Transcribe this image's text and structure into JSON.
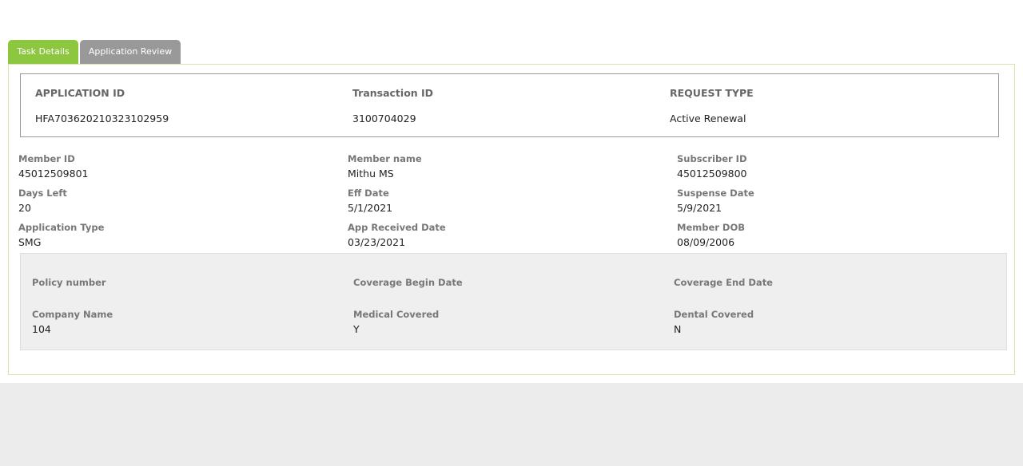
{
  "tabs": [
    {
      "label": "Task Details",
      "active": true
    },
    {
      "label": "Application Review",
      "active": false
    }
  ],
  "summary": {
    "application_id": {
      "label": "APPLICATION ID",
      "value": "HFA703620210323102959"
    },
    "transaction_id": {
      "label": "Transaction ID",
      "value": "3100704029"
    },
    "request_type": {
      "label": "REQUEST TYPE",
      "value": "Active Renewal"
    }
  },
  "details": {
    "member_id": {
      "label": "Member ID",
      "value": "45012509801"
    },
    "member_name": {
      "label": "Member name",
      "value": "Mithu MS"
    },
    "subscriber_id": {
      "label": "Subscriber ID",
      "value": "45012509800"
    },
    "days_left": {
      "label": "Days Left",
      "value": "20"
    },
    "eff_date": {
      "label": "Eff Date",
      "value": "5/1/2021"
    },
    "suspense_date": {
      "label": "Suspense Date",
      "value": "5/9/2021"
    },
    "application_type": {
      "label": "Application Type",
      "value": "SMG"
    },
    "app_received_date": {
      "label": "App Received Date",
      "value": "03/23/2021"
    },
    "member_dob": {
      "label": "Member DOB",
      "value": "08/09/2006"
    }
  },
  "coverage": {
    "policy_number": {
      "label": "Policy number",
      "value": ""
    },
    "coverage_begin_date": {
      "label": "Coverage Begin Date",
      "value": ""
    },
    "coverage_end_date": {
      "label": "Coverage End Date",
      "value": ""
    },
    "company_name": {
      "label": "Company Name",
      "value": "104"
    },
    "medical_covered": {
      "label": "Medical Covered",
      "value": "Y"
    },
    "dental_covered": {
      "label": "Dental Covered",
      "value": "N"
    }
  },
  "colors": {
    "tab_active": "#8dc63f",
    "tab_inactive": "#999999",
    "panel_border": "#d6e4b3",
    "coverage_bg": "#efefef"
  }
}
